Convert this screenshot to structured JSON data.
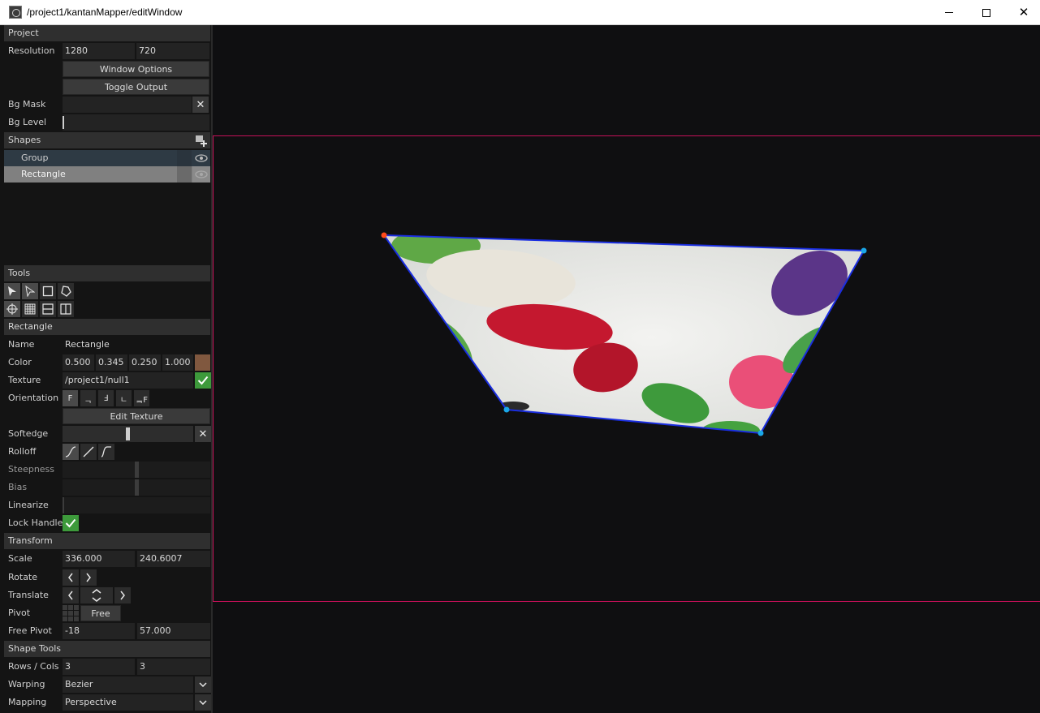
{
  "window": {
    "title": "/project1/kantanMapper/editWindow",
    "minimize_icon": "minimize-icon",
    "maximize_icon": "maximize-icon",
    "close_glyph": "✕"
  },
  "project": {
    "header": "Project",
    "resolution_label": "Resolution",
    "resolution_w": "1280",
    "resolution_h": "720",
    "window_options": "Window Options",
    "toggle_output": "Toggle Output",
    "bg_mask_label": "Bg Mask",
    "bg_mask_value": "",
    "bg_level_label": "Bg Level",
    "bg_level": 0.0
  },
  "shapes": {
    "header": "Shapes",
    "items": [
      {
        "name": "Group",
        "visible": true,
        "selected": false
      },
      {
        "name": "Rectangle",
        "visible": true,
        "selected": true
      }
    ]
  },
  "tools": {
    "header": "Tools",
    "row1": [
      "select-arrow-icon",
      "select-vertex-icon",
      "rectangle-tool-icon",
      "polygon-tool-icon"
    ],
    "row2": [
      "crosshair-tool-icon",
      "grid-tool-icon",
      "horizontal-split-icon",
      "vertical-split-icon"
    ]
  },
  "rectangle": {
    "header": "Rectangle",
    "name_label": "Name",
    "name_value": "Rectangle",
    "color_label": "Color",
    "color_values": [
      "0.500",
      "0.345",
      "0.250",
      "1.000"
    ],
    "color_swatch": "#80583f",
    "texture_label": "Texture",
    "texture_value": "/project1/null1",
    "orientation_label": "Orientation",
    "orientation_options": [
      "F",
      "ᆨ",
      "Ⅎ",
      "ㄴ",
      "ᆿF"
    ],
    "edit_texture": "Edit Texture",
    "softedge_label": "Softedge",
    "softedge": 0.5,
    "rolloff_label": "Rolloff",
    "steepness_label": "Steepness",
    "steepness": 0.5,
    "bias_label": "Bias",
    "bias": 0.5,
    "linearize_label": "Linearize",
    "linearize": 0.0,
    "lock_handle_label": "Lock Handle",
    "lock_handle": true
  },
  "transform": {
    "header": "Transform",
    "scale_label": "Scale",
    "scale_x": "336.000",
    "scale_y": "240.6007",
    "rotate_label": "Rotate",
    "translate_label": "Translate",
    "pivot_label": "Pivot",
    "pivot_mode": "Free",
    "free_pivot_label": "Free Pivot",
    "free_pivot_x": "-18",
    "free_pivot_y": "57.000"
  },
  "shape_tools": {
    "header": "Shape Tools",
    "rows_cols_label": "Rows / Cols",
    "rows": "3",
    "cols": "3",
    "warping_label": "Warping",
    "warping_value": "Bezier",
    "mapping_label": "Mapping",
    "mapping_value": "Perspective"
  },
  "colors": {
    "output_frame": "#c41058",
    "shape_outline": "#1a2ee0",
    "handle": "#1aa7e8",
    "handle_active": "#ff4a1a",
    "check_green": "#3d9a3b",
    "shape_row_selected": "#808080",
    "shape_row_group": "#2e3a44"
  },
  "canvas": {
    "texture_subject": "jelly beans photo"
  }
}
